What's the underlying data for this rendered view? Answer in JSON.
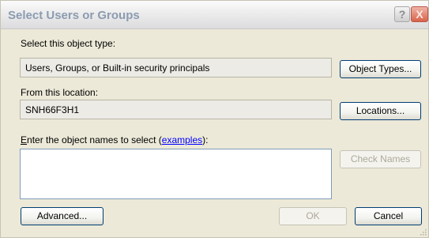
{
  "window": {
    "title": "Select Users or Groups",
    "help_glyph": "?",
    "close_glyph": "X"
  },
  "object_type": {
    "label": "Select this object type:",
    "value": "Users, Groups, or Built-in security principals",
    "button": "Object Types..."
  },
  "location": {
    "label": "From this location:",
    "value": "SNH66F3H1",
    "button": "Locations..."
  },
  "names": {
    "label_mnemonic": "E",
    "label_before": "nter the object names to select (",
    "label_link": "examples",
    "label_after": "):",
    "value": "",
    "check_button": "Check Names"
  },
  "footer": {
    "advanced_button": "Advanced...",
    "ok_button": "OK",
    "cancel_button": "Cancel"
  }
}
